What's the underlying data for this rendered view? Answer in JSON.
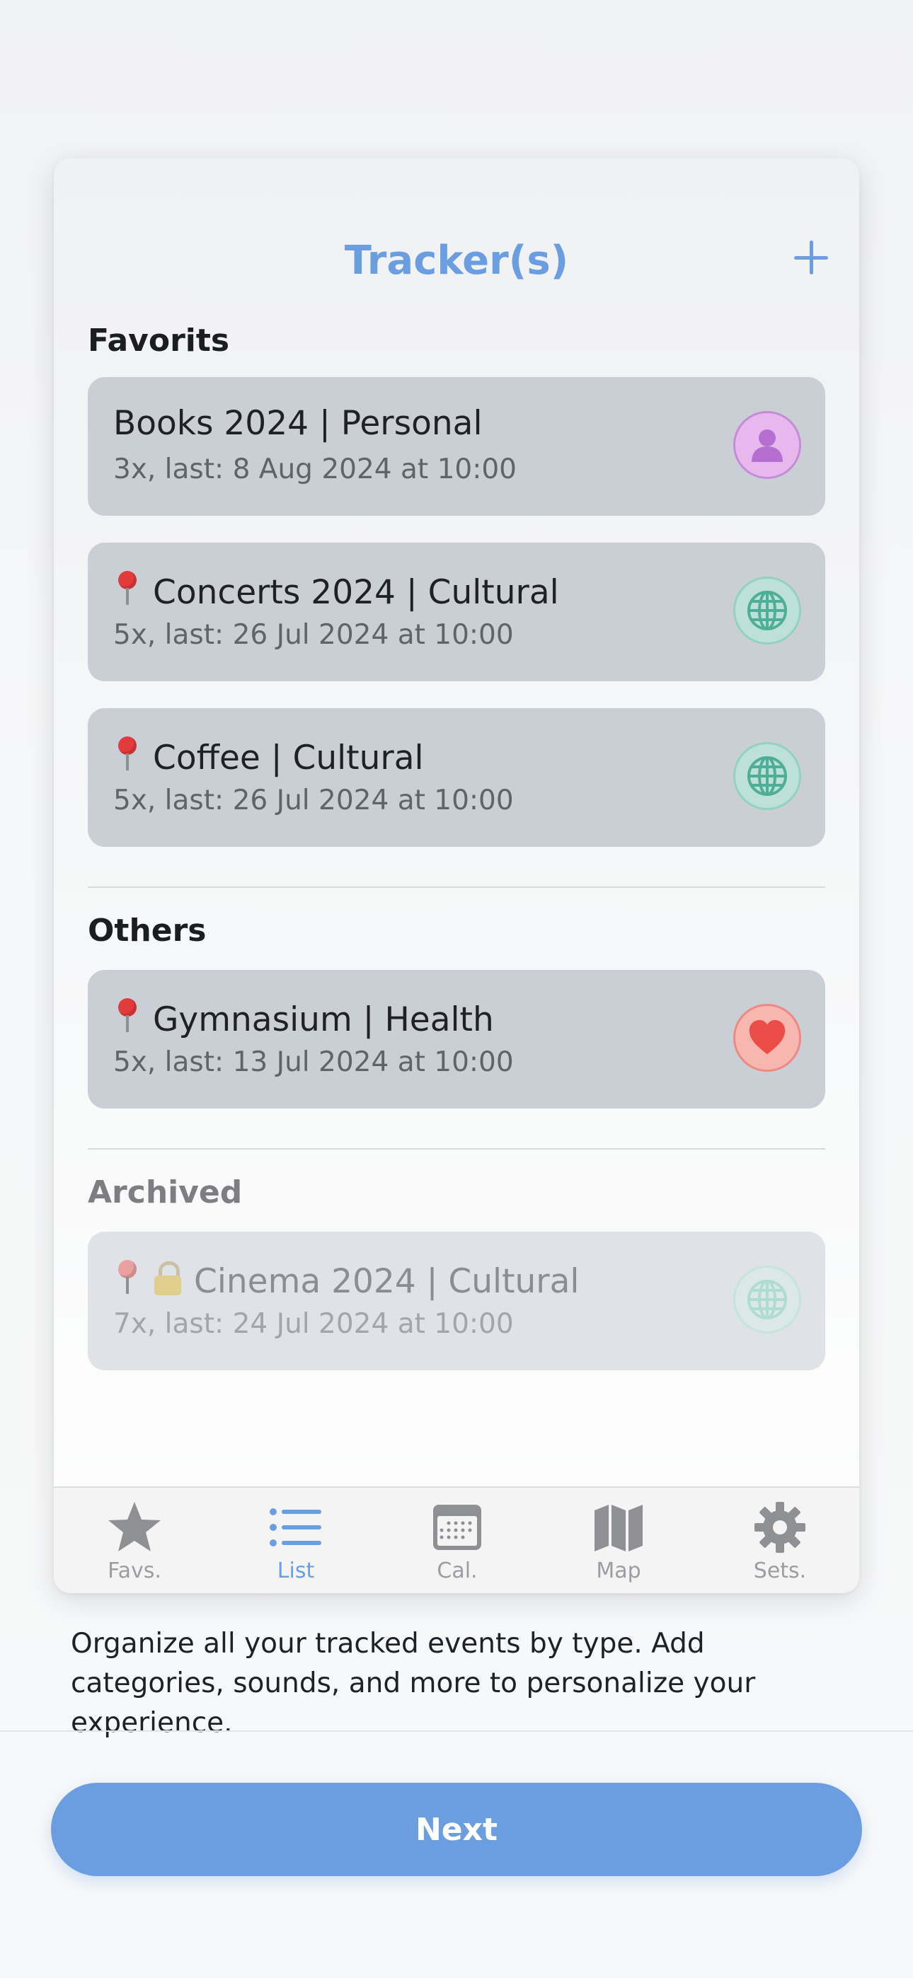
{
  "header": {
    "title": "Tracker(s)",
    "add_icon": "plus-icon"
  },
  "sections": {
    "favorites": "Favorits",
    "others": "Others",
    "archived": "Archived"
  },
  "trackers": {
    "books": {
      "name": "Books 2024 | Personal",
      "sub": "3x, last: 8 Aug 2024 at 10:00",
      "icon": "person-icon",
      "color": "#c58bd6"
    },
    "concerts": {
      "name": "Concerts 2024 | Cultural",
      "sub": "5x, last: 26 Jul 2024 at 10:00",
      "icon": "globe-icon",
      "color": "#5fb9a3"
    },
    "coffee": {
      "name": "Coffee | Cultural",
      "sub": "5x, last: 26 Jul 2024 at 10:00",
      "icon": "globe-icon",
      "color": "#5fb9a3"
    },
    "gym": {
      "name": "Gymnasium | Health",
      "sub": "5x, last: 13 Jul 2024 at 10:00",
      "icon": "heart-icon",
      "color": "#ea5550"
    },
    "cinema": {
      "name": "Cinema 2024 | Cultural",
      "sub": "7x, last: 24 Jul 2024 at 10:00",
      "icon": "globe-icon",
      "color": "#5fb9a3"
    }
  },
  "tabbar": {
    "favs": "Favs.",
    "list": "List",
    "cal": "Cal.",
    "map": "Map",
    "sets": "Sets."
  },
  "description": "Organize all your tracked events by type. Add categories, sounds, and more to personalize your experience.",
  "next_button": "Next",
  "colors": {
    "accent": "#6a9ee0",
    "row": "#cacfd5",
    "tab_inactive": "#9b9da1"
  }
}
